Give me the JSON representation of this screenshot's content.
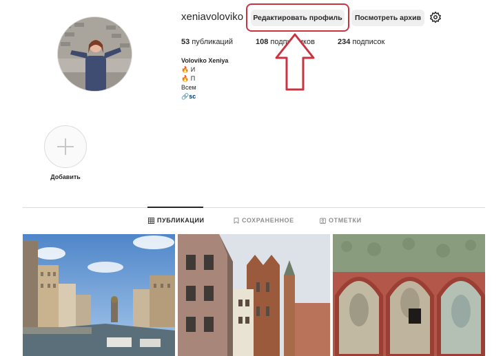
{
  "profile": {
    "username": "xeniavoloviko",
    "edit_button": "Редактировать профиль",
    "archive_button": "Посмотреть архив"
  },
  "stats": {
    "posts_count": "53",
    "posts_label": "публикаций",
    "followers_count": "108",
    "followers_label": "подписчиков",
    "following_count": "234",
    "following_label": "подписок"
  },
  "bio": {
    "full_name": "Voloviko Xeniya",
    "line1": "🔥 И",
    "line2": "🔥 П",
    "line3": "Всем",
    "link": "sc"
  },
  "highlights": {
    "add_label": "Добавить"
  },
  "tabs": [
    {
      "label": "ПУБЛИКАЦИИ",
      "icon": "grid-icon",
      "active": true
    },
    {
      "label": "СОХРАНЕННОЕ",
      "icon": "bookmark-icon",
      "active": false
    },
    {
      "label": "ОТМЕТКИ",
      "icon": "tagged-icon",
      "active": false
    }
  ],
  "colors": {
    "annotation_red": "#c93340",
    "link_blue": "#00376b"
  }
}
